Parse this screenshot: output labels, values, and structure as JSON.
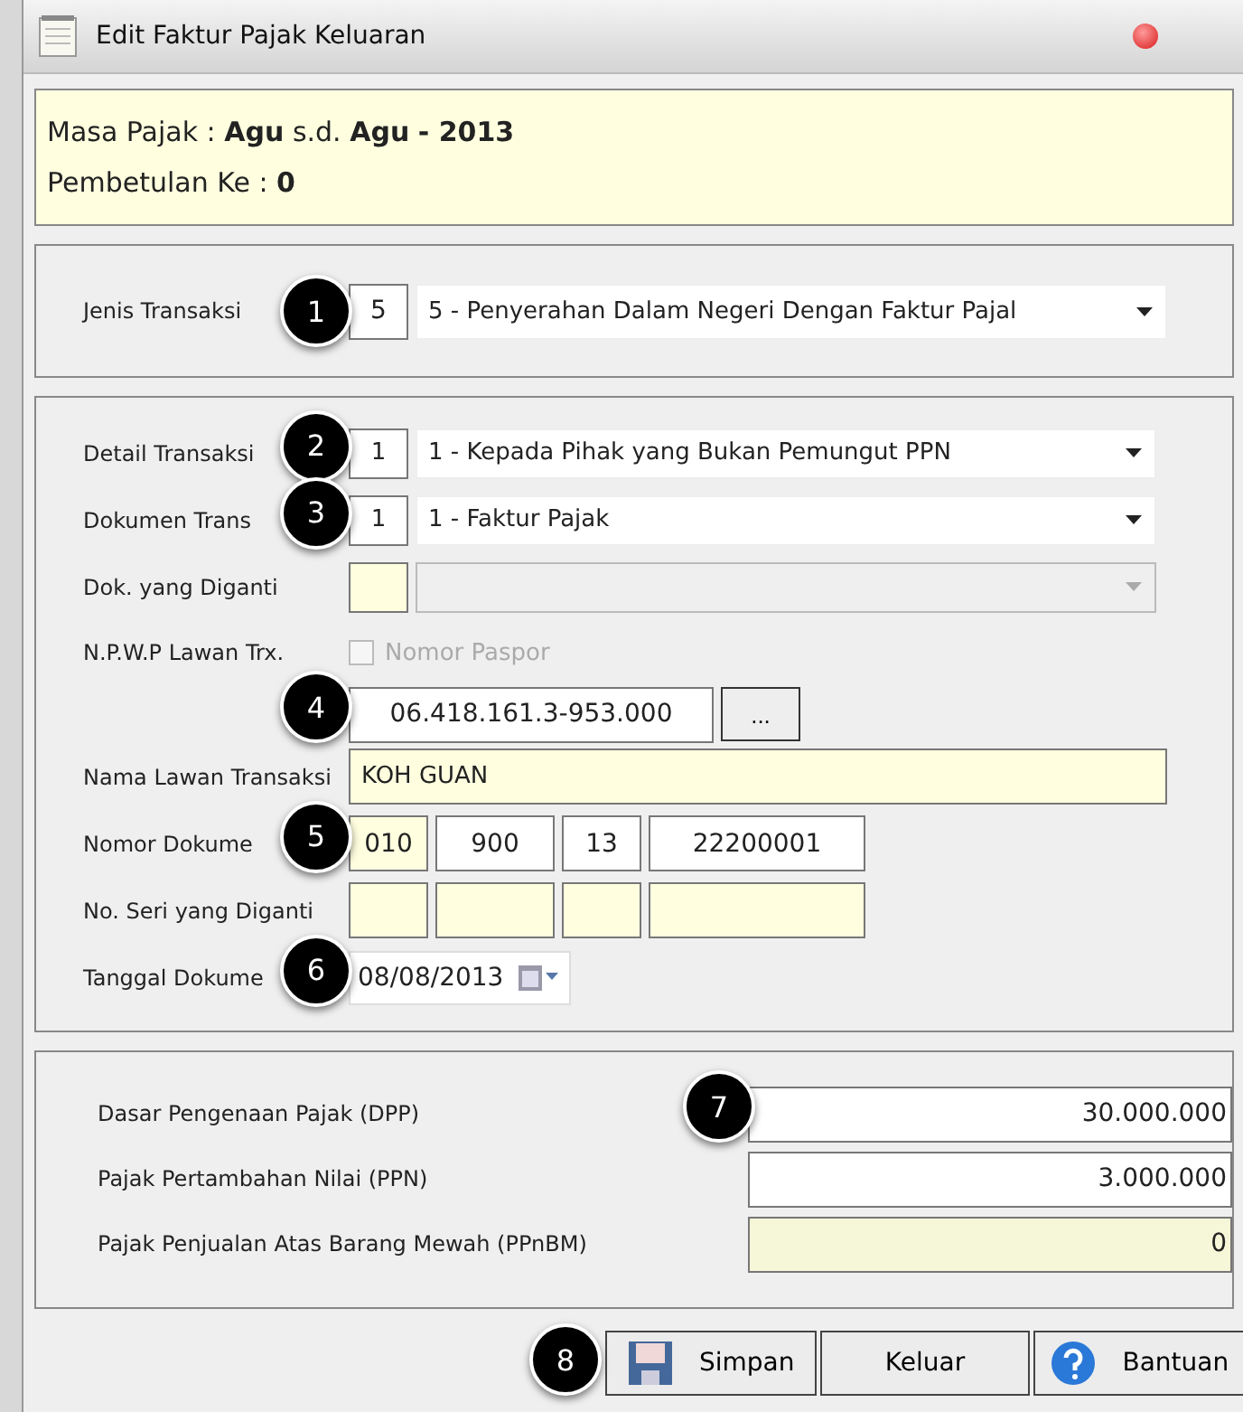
{
  "window": {
    "title": "Edit Faktur Pajak Keluaran"
  },
  "info": {
    "masa_label": "Masa Pajak :",
    "masa_from": "Agu",
    "masa_sd": "s.d.",
    "masa_to": "Agu",
    "masa_year": "- 2013",
    "pembetulan_label": "Pembetulan Ke :",
    "pembetulan_value": "0"
  },
  "jenis": {
    "label": "Jenis Transaksi",
    "callout": "1",
    "code": "5",
    "value": "5 - Penyerahan Dalam Negeri Dengan Faktur Pajal"
  },
  "detail_rows": [
    {
      "kind": "combo",
      "label": "Detail Transaksi",
      "callout": "2",
      "code": "1",
      "value": "1 - Kepada Pihak yang Bukan Pemungut PPN",
      "disabled": false
    },
    {
      "kind": "combo",
      "label": "Dokumen Trans",
      "callout": "3",
      "code": "1",
      "value": "1 - Faktur Pajak",
      "disabled": false
    },
    {
      "kind": "combo",
      "label": "Dok. yang Diganti",
      "disabled": true
    },
    {
      "kind": "checkbox",
      "label": "N.P.W.P Lawan Trx.",
      "checkbox_label": "Nomor Paspor",
      "checked": false,
      "disabled": true
    },
    {
      "kind": "npwp",
      "callout": "4",
      "value": "06.418.161.3-953.000",
      "button": "..."
    },
    {
      "kind": "text",
      "label": "Nama Lawan Transaksi",
      "value": "KOH GUAN"
    },
    {
      "kind": "segments",
      "label": "Nomor Dokume",
      "callout": "5",
      "values": [
        "010",
        "900",
        "13",
        "22200001"
      ]
    },
    {
      "kind": "blank_segments",
      "label": "No. Seri yang Diganti"
    },
    {
      "kind": "date",
      "label": "Tanggal Dokume",
      "callout": "6",
      "value": "08/08/2013"
    }
  ],
  "amounts": {
    "callout": "7",
    "rows": [
      {
        "label": "Dasar Pengenaan Pajak (DPP)",
        "value": "30.000.000",
        "readonly": false
      },
      {
        "label": "Pajak Pertambahan Nilai (PPN)",
        "value": "3.000.000",
        "readonly": false
      },
      {
        "label": "Pajak Penjualan Atas Barang Mewah (PPnBM)",
        "value": "0",
        "readonly": true
      }
    ]
  },
  "buttons": {
    "callout": "8",
    "items": [
      {
        "kind": "save",
        "label": "Simpan"
      },
      {
        "kind": "plain",
        "label": "Keluar"
      },
      {
        "kind": "help",
        "label": "Bantuan"
      }
    ]
  }
}
